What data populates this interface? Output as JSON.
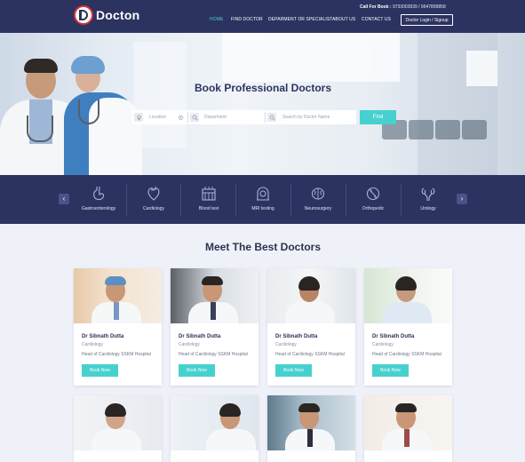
{
  "header": {
    "brand": "Docton",
    "call_label": "Call For Book :",
    "call_numbers": "9733003939 / 9647899858",
    "nav": [
      "HOME",
      "FIND DOCTOR",
      "DEPARMENT OR SPECIALIST",
      "ABOUT US",
      "CONTACT US"
    ],
    "active_nav": "HOME",
    "login_button": "Doctor Login / Signup"
  },
  "hero": {
    "title": "Book Professional Doctors",
    "search": {
      "location_placeholder": "Location",
      "department_placeholder": "Deparment",
      "doctor_placeholder": "Search by Doctor Name",
      "find_button": "Find"
    }
  },
  "specialties": {
    "prev_icon": "chevron-left-icon",
    "next_icon": "chevron-right-icon",
    "items": [
      {
        "label": "Gastroenterology",
        "icon": "stomach-icon"
      },
      {
        "label": "Cardiology",
        "icon": "heart-icon"
      },
      {
        "label": "Blood test",
        "icon": "blood-test-icon"
      },
      {
        "label": "MRI testing",
        "icon": "mri-icon"
      },
      {
        "label": "Neurosurgery",
        "icon": "brain-icon"
      },
      {
        "label": "Orthopedic",
        "icon": "bone-icon"
      },
      {
        "label": "Urology",
        "icon": "kidney-icon"
      }
    ]
  },
  "doctors": {
    "title": "Meet The Best Doctors",
    "cards": [
      {
        "name": "Dr Sibnath Dutta",
        "specialty": "Cardiology",
        "role": "Head of Cardiology SSKM Hospital",
        "button": "Book Now"
      },
      {
        "name": "Dr Sibnath Dutta",
        "specialty": "Cardiology",
        "role": "Head of Cardiology SSKM Hospital",
        "button": "Book Now"
      },
      {
        "name": "Dr Sibnath Dutta",
        "specialty": "Cardiology",
        "role": "Head of Cardiology SSKM Hospital",
        "button": "Book Now"
      },
      {
        "name": "Dr Sibnath Dutta",
        "specialty": "Cardiology",
        "role": "Head of Cardiology SSKM Hospital",
        "button": "Book Now"
      }
    ]
  },
  "colors": {
    "navy": "#2c3361",
    "accent": "#46d1cf",
    "logo_red": "#d9332f",
    "page_bg": "#eef1f8"
  }
}
